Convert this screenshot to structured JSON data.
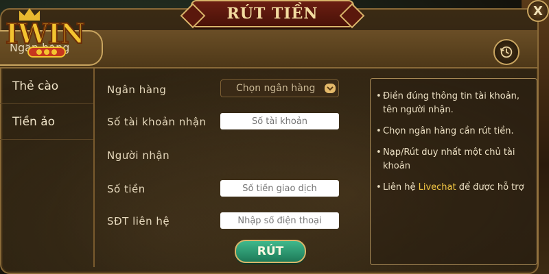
{
  "dialog": {
    "title": "RÚT TIỀN",
    "close_label": "X",
    "history_icon": "history-icon"
  },
  "logo": {
    "text": "IWIN",
    "badge": "888"
  },
  "header": {
    "behind_label": "Ngân hàng"
  },
  "menu": {
    "items": [
      {
        "label": "Thẻ cào"
      },
      {
        "label": "Tiền ảo"
      }
    ]
  },
  "form": {
    "bank_label": "Ngân hàng",
    "bank_placeholder": "Chọn ngân hàng",
    "account_label": "Số tài khoản nhận",
    "account_placeholder": "Số tài khoản",
    "receiver_label": "Người nhận",
    "amount_label": "Số tiền",
    "amount_placeholder": "Số tiền giao dịch",
    "phone_label": "SĐT liên hệ",
    "phone_placeholder": "Nhập số điện thoại",
    "submit_label": "RÚT"
  },
  "notes": {
    "items": [
      {
        "text": "Điền đúng thông tin tài khoản, tên người nhận."
      },
      {
        "text": "Chọn ngân hàng cần rút tiền."
      },
      {
        "text": "Nạp/Rút duy nhất một chủ tài khoản"
      }
    ],
    "livechat_prefix": "Liên hệ ",
    "livechat_link": "Livechat",
    "livechat_suffix": " để được hỗ trợ"
  },
  "colors": {
    "accent_gold": "#d8b46a",
    "title_red": "#6b1e12",
    "submit_green": "#2e9a70",
    "highlight_yellow": "#f6c945"
  }
}
